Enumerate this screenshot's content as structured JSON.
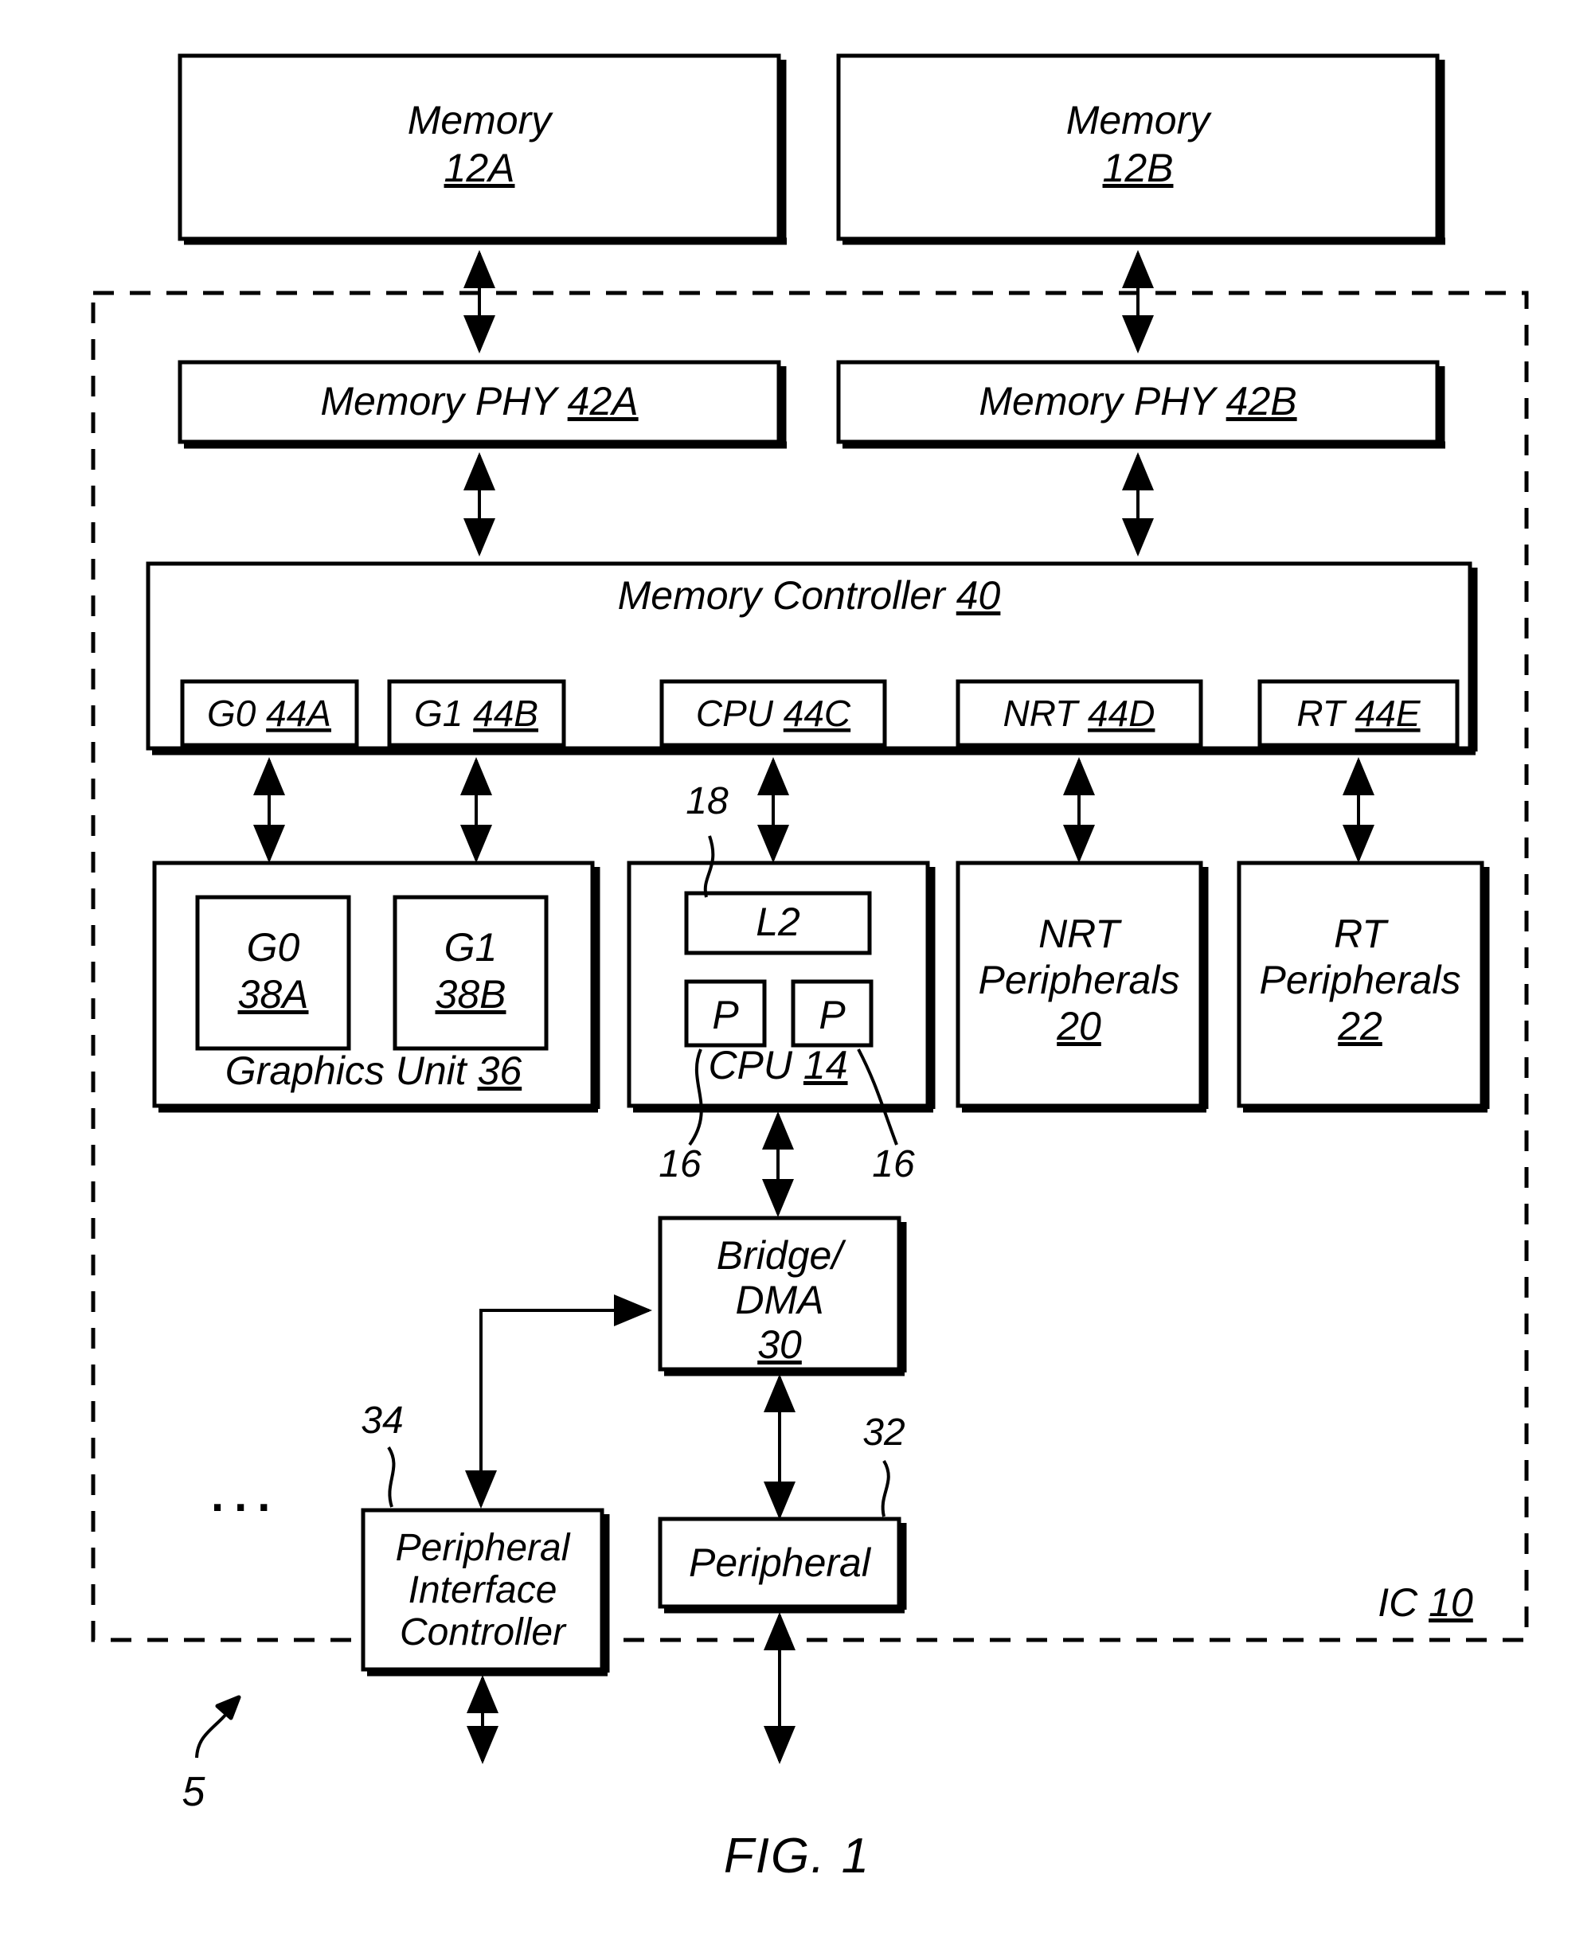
{
  "figure": {
    "caption": "FIG. 1",
    "system_ref": "5",
    "chip_label": "IC",
    "chip_ref": "10",
    "ellipsis": "..."
  },
  "blocks": {
    "memory_a": {
      "label": "Memory",
      "ref": "12A"
    },
    "memory_b": {
      "label": "Memory",
      "ref": "12B"
    },
    "phy_a": {
      "label": "Memory PHY",
      "ref": "42A"
    },
    "phy_b": {
      "label": "Memory PHY",
      "ref": "42B"
    },
    "mem_ctrl": {
      "label": "Memory Controller",
      "ref": "40"
    },
    "graphics": {
      "label": "Graphics Unit",
      "ref": "36"
    },
    "g0_core": {
      "label": "G0",
      "ref": "38A"
    },
    "g1_core": {
      "label": "G1",
      "ref": "38B"
    },
    "cpu": {
      "label": "CPU",
      "ref": "14"
    },
    "l2": {
      "label": "L2",
      "ref": "18"
    },
    "proc_left": {
      "label": "P",
      "ref": "16"
    },
    "proc_right": {
      "label": "P",
      "ref": "16"
    },
    "nrt_periph": {
      "line1": "NRT",
      "line2": "Peripherals",
      "ref": "20"
    },
    "rt_periph": {
      "line1": "RT",
      "line2": "Peripherals",
      "ref": "22"
    },
    "bridge_dma": {
      "line1": "Bridge/",
      "line2": "DMA",
      "ref": "30"
    },
    "periph_iface_ctrl": {
      "line1": "Peripheral",
      "line2": "Interface",
      "line3": "Controller",
      "ref": "34"
    },
    "peripheral": {
      "label": "Peripheral",
      "ref": "32"
    }
  },
  "ports": [
    {
      "label": "G0",
      "ref": "44A"
    },
    {
      "label": "G1",
      "ref": "44B"
    },
    {
      "label": "CPU",
      "ref": "44C"
    },
    {
      "label": "NRT",
      "ref": "44D"
    },
    {
      "label": "RT",
      "ref": "44E"
    }
  ],
  "colors": {
    "ink": "#000000",
    "paper": "#ffffff"
  }
}
